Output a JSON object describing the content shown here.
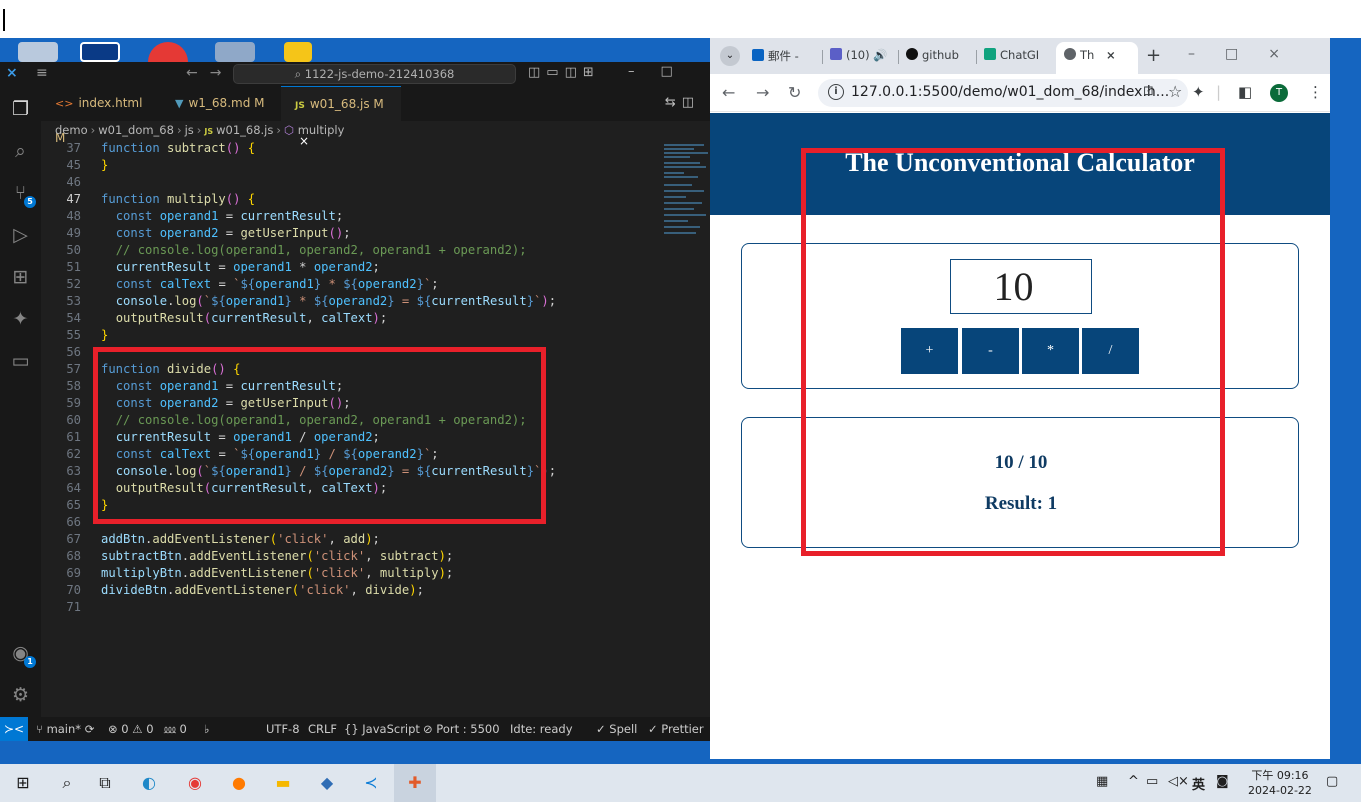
{
  "vscode": {
    "search_text": "1122-js-demo-212410368",
    "tabs": [
      {
        "icon": "<>",
        "label": "index.html M"
      },
      {
        "icon": "▼",
        "label": "w1_68.md M"
      },
      {
        "icon": "JS",
        "label": "w01_68.js M"
      }
    ],
    "tab_close": "×",
    "breadcrumb": [
      "demo",
      "w01_dom_68",
      "js",
      "w01_68.js",
      "multiply"
    ],
    "breadcrumb_js_badge": "JS",
    "activity_badges": {
      "source_control": "5",
      "accounts": "1"
    },
    "status": {
      "branch": "main*",
      "problems": "⊗ 0 ⚠ 0",
      "ports": "⅏ 0",
      "encoding": "UTF-8",
      "eol": "CRLF",
      "language": "{} JavaScript",
      "port": "⊘ Port : 5500",
      "ide": "Idte: ready",
      "spell": "✓ Spell",
      "prettier": "✓ Prettier"
    }
  },
  "chrome": {
    "tabs": [
      {
        "label": "郵件 - "
      },
      {
        "label": "(10) "
      },
      {
        "label": "github"
      },
      {
        "label": "ChatGI"
      },
      {
        "label": "Th"
      }
    ],
    "tab_close": "×",
    "new_tab": "+",
    "url": "127.0.0.1:5500/demo/w01_dom_68/index.h...",
    "avatar_letter": "T"
  },
  "page": {
    "title": "The Unconventional Calculator",
    "input_value": "10",
    "ops": [
      "+",
      "-",
      "*",
      "/"
    ],
    "calc_text": "10 / 10",
    "result_text": "Result: 1"
  },
  "taskbar": {
    "ime": "英",
    "time": "下午 09:16",
    "date": "2024-02-22"
  },
  "colors": {
    "vscode_bg": "#1f1f1f",
    "accent_blue": "#0078d4",
    "page_header": "#07457a",
    "highlight_red": "#e8202a",
    "wallpaper": "#1565c0"
  }
}
